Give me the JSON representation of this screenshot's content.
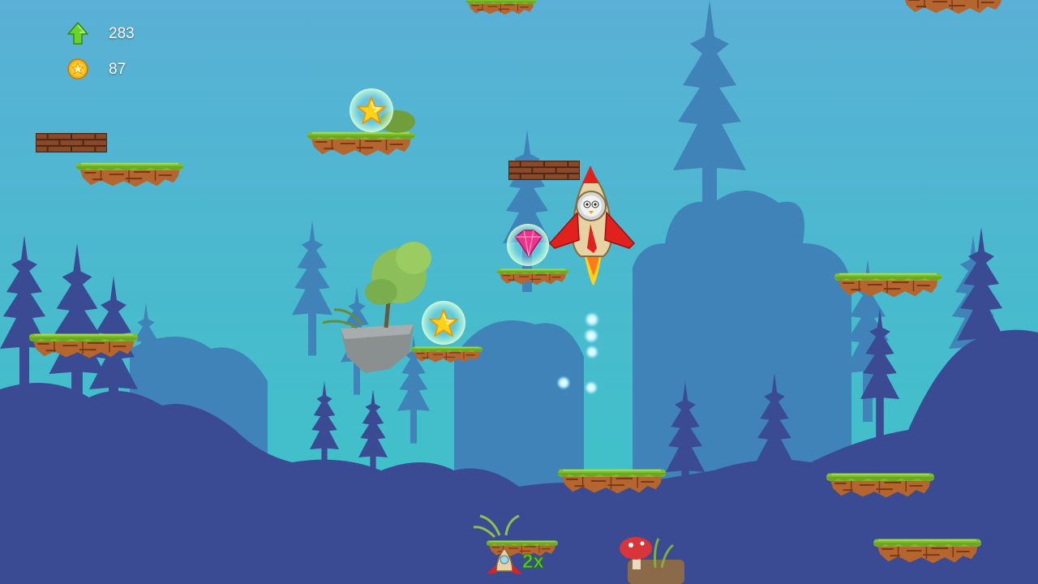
{
  "hud": {
    "height_icon": "green-up-arrow-icon",
    "height_value": "283",
    "coins_icon": "gold-star-coin-icon",
    "coins_value": "87"
  },
  "colors": {
    "sky_top": "#5ab0d6",
    "sky_bottom": "#3cc4c8",
    "forest_far": "#3f83b8",
    "forest_near": "#3a4b94",
    "grass": "#7fbf2a",
    "dirt": "#b5652e",
    "rocket_red": "#e0211d",
    "rocket_body": "#e7d2a4"
  },
  "game": {
    "player": "rocket-character",
    "collectibles": [
      "star-bubble",
      "star-bubble",
      "gem-bubble"
    ],
    "powerups": [
      "mini-rocket-powerup",
      "2x-multiplier-powerup"
    ]
  }
}
